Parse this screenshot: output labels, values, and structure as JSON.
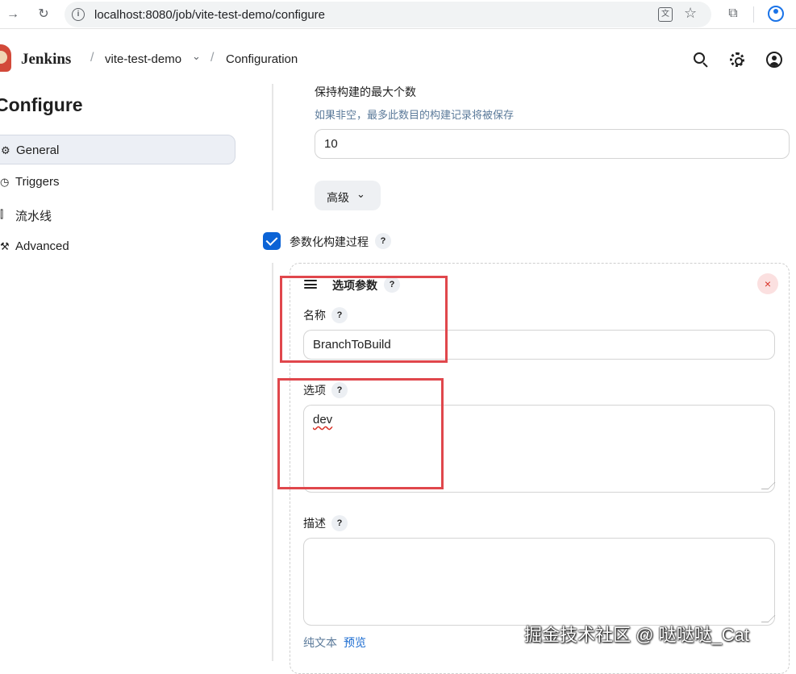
{
  "browser": {
    "back_icon": "arrow-right-icon",
    "reload_icon": "reload-icon",
    "url": "localhost:8080/job/vite-test-demo/configure"
  },
  "header": {
    "app_name": "Jenkins",
    "breadcrumb": [
      "vite-test-demo",
      "Configuration"
    ],
    "separator": "/"
  },
  "sidebar": {
    "title": "Configure",
    "items": [
      {
        "label": "General",
        "icon": "gear-icon",
        "active": true
      },
      {
        "label": "Triggers",
        "icon": "clock-icon",
        "active": false
      },
      {
        "label": "流水线",
        "icon": "pipeline-icon",
        "active": false
      },
      {
        "label": "Advanced",
        "icon": "wrench-icon",
        "active": false
      }
    ]
  },
  "main": {
    "max_builds": {
      "label": "保持构建的最大个数",
      "description": "如果非空，最多此数目的构建记录将被保存",
      "value": "10"
    },
    "advanced_button": "高级",
    "parameterized": {
      "label": "参数化构建过程",
      "checked": true
    },
    "choice_parameter": {
      "title": "选项参数",
      "name_label": "名称",
      "name_value": "BranchToBuild",
      "choices_label": "选项",
      "choices_value": "dev",
      "description_label": "描述",
      "description_value": "",
      "format_tabs": [
        "纯文本",
        "预览"
      ]
    },
    "help_glyph": "?",
    "close_glyph": "×"
  },
  "watermark": "掘金技术社区 @ 哒哒哒_Cat",
  "colors": {
    "accent": "#0b63d6",
    "highlight_box": "#e0474c",
    "link": "#1a6bd0"
  }
}
